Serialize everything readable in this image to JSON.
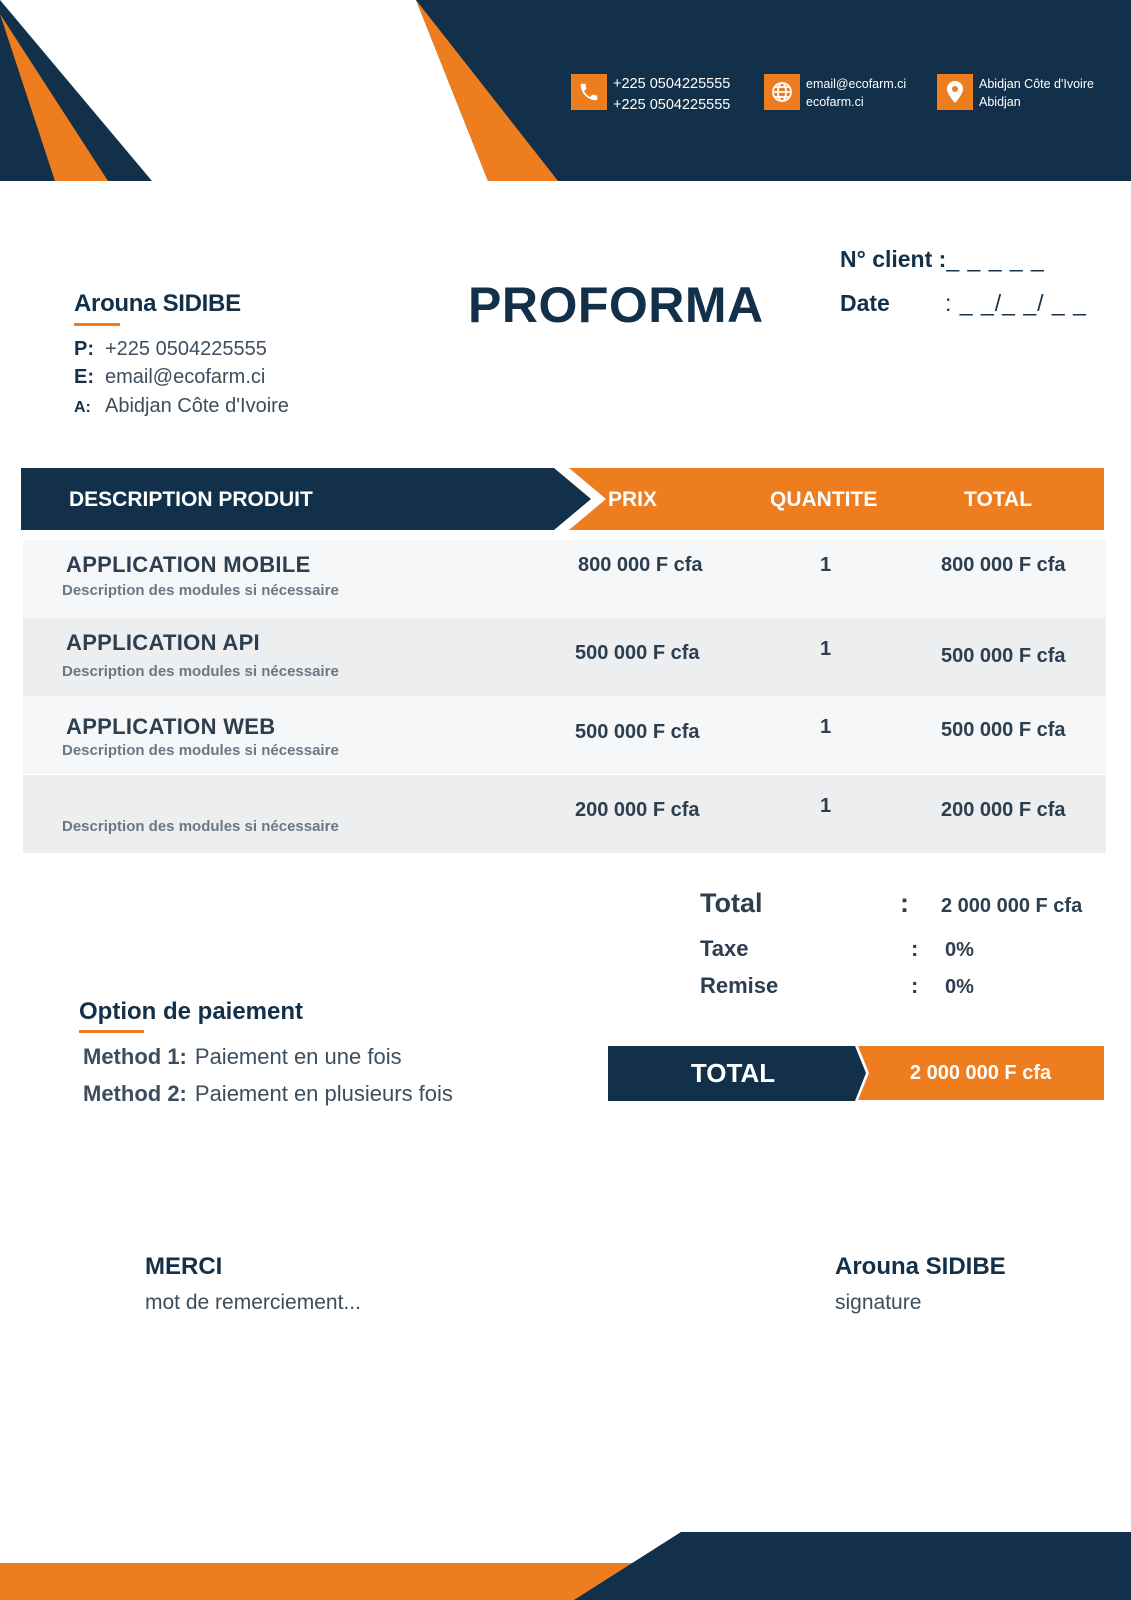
{
  "colors": {
    "navy": "#12304a",
    "orange": "#ee7d1f",
    "row_light": "#f6f7f8",
    "row_dark": "#eceef0"
  },
  "header": {
    "phone": {
      "icon": "phone-icon",
      "lines": [
        "+225 0504225555",
        "+225 0504225555"
      ]
    },
    "web": {
      "icon": "globe-icon",
      "lines": [
        "email@ecofarm.ci",
        "ecofarm.ci"
      ]
    },
    "address": {
      "icon": "location-pin-icon",
      "lines": [
        "Abidjan Côte d'Ivoire",
        "Abidjan"
      ]
    }
  },
  "client": {
    "name": "Arouna SIDIBE",
    "phone_key": "P:",
    "phone": "+225 0504225555",
    "email_key": "E:",
    "email": "email@ecofarm.ci",
    "address_key": "A:",
    "address": "Abidjan Côte d'Ivoire"
  },
  "document": {
    "title": "PROFORMA",
    "client_no_label": "N° client :",
    "client_no_value": " _ _ _ _ _",
    "date_label": "Date",
    "date_value": ":  _ _/_ _/ _ _"
  },
  "table": {
    "headers": {
      "description": "DESCRIPTION PRODUIT",
      "price": "PRIX",
      "quantity": "QUANTITE",
      "total": "TOTAL"
    },
    "rows": [
      {
        "name": "APPLICATION MOBILE",
        "desc": "Description des modules si nécessaire",
        "price": "800 000 F cfa",
        "qty": "1",
        "total": "800 000 F cfa"
      },
      {
        "name": "APPLICATION API",
        "desc": "Description des modules si nécessaire",
        "price": "500 000 F cfa",
        "qty": "1",
        "total": "500 000 F cfa"
      },
      {
        "name": "APPLICATION WEB",
        "desc": "Description des modules si nécessaire",
        "price": "500 000 F cfa",
        "qty": "1",
        "total": "500 000 F cfa"
      },
      {
        "name": "",
        "desc": "Description des modules si nécessaire",
        "price": "200 000 F cfa",
        "qty": "1",
        "total": "200 000 F cfa"
      }
    ]
  },
  "summary": {
    "total_label": "Total",
    "total_value": "2 000 000 F cfa",
    "tax_label": "Taxe",
    "tax_value": "0%",
    "discount_label": "Remise",
    "discount_value": "0%",
    "colon": ":"
  },
  "payment": {
    "title": "Option de paiement",
    "method1_key": "Method 1:",
    "method1": "Paiement en une fois",
    "method2_key": "Method 2:",
    "method2": "Paiement en plusieurs fois"
  },
  "grand_total": {
    "label": "TOTAL",
    "value": "2 000 000 F cfa"
  },
  "footer": {
    "thanks_title": "MERCI",
    "thanks_text": "mot de remerciement...",
    "signer": "Arouna SIDIBE",
    "signature_label": "signature"
  }
}
